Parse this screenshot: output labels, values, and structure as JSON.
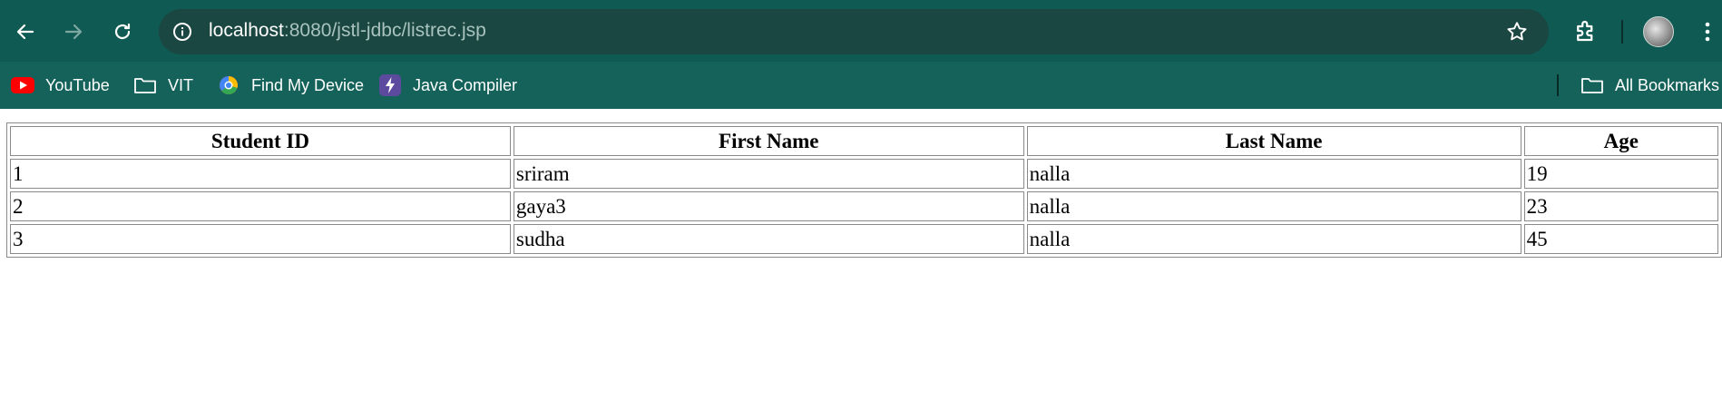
{
  "browser": {
    "url_host": "localhost",
    "url_rest": ":8080/jstl-jdbc/listrec.jsp",
    "colors": {
      "toolbar": "#0f5a52",
      "bookmarks_bar": "#14625a",
      "omnibox": "#1a4741"
    }
  },
  "bookmarks": [
    {
      "label": "YouTube",
      "icon": "youtube-icon"
    },
    {
      "label": "VIT",
      "icon": "folder-icon"
    },
    {
      "label": "Find My Device",
      "icon": "find-my-device-icon"
    },
    {
      "label": "Java Compiler",
      "icon": "bolt-icon"
    }
  ],
  "all_bookmarks": {
    "label": "All Bookmarks",
    "icon": "folder-icon"
  },
  "table": {
    "headers": [
      "Student ID",
      "First Name",
      "Last Name",
      "Age"
    ],
    "rows": [
      [
        "1",
        "sriram",
        "nalla",
        "19"
      ],
      [
        "2",
        "gaya3",
        "nalla",
        "23"
      ],
      [
        "3",
        "sudha",
        "nalla",
        "45"
      ]
    ]
  }
}
